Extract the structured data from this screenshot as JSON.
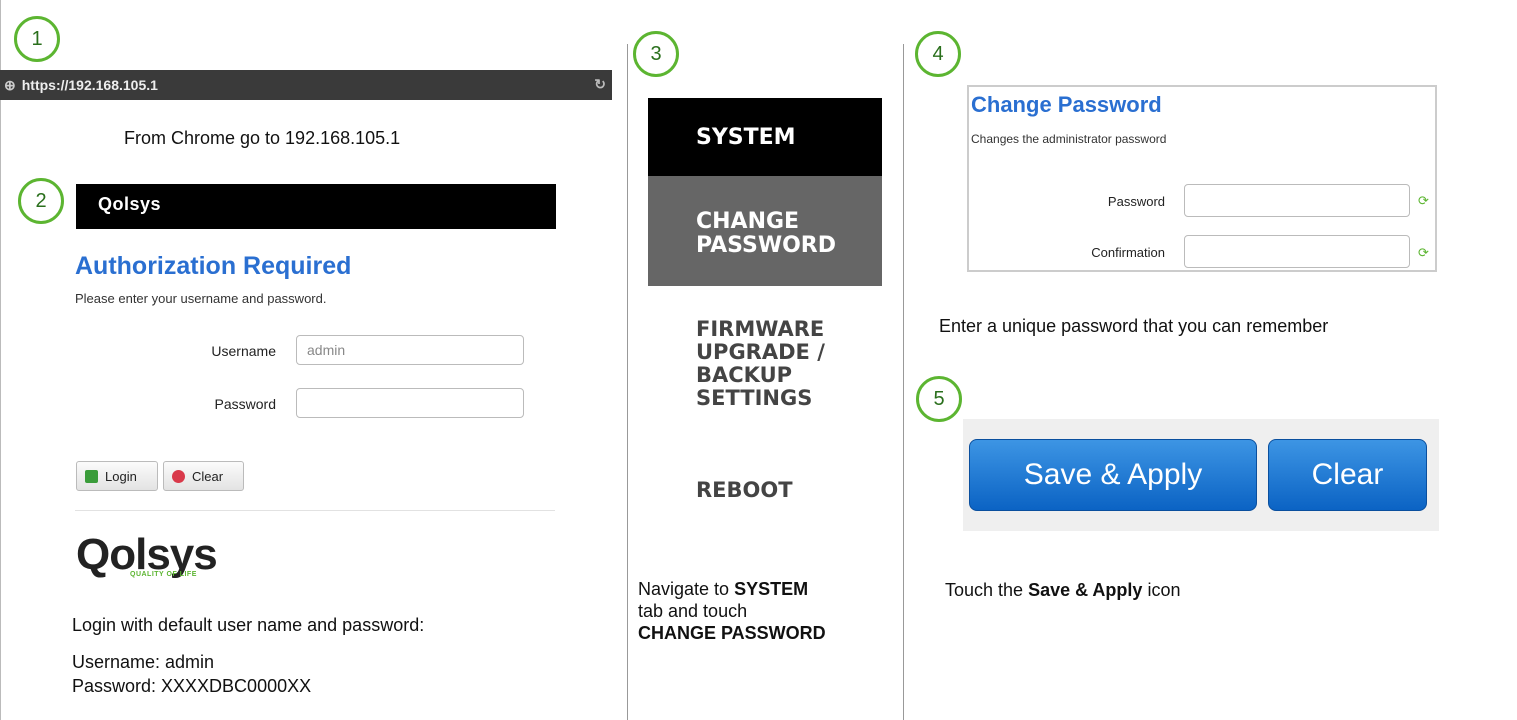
{
  "steps": {
    "one": "1",
    "two": "2",
    "three": "3",
    "four": "4",
    "five": "5"
  },
  "panel1": {
    "url": "https://192.168.105.1",
    "url_caption": "From Chrome go to 192.168.105.1",
    "login_logo": "Qolsys",
    "auth_title": "Authorization Required",
    "auth_subtitle": "Please enter your username and password.",
    "username_label": "Username",
    "username_value": "admin",
    "password_label": "Password",
    "password_value": "",
    "login_button": "Login",
    "clear_button": "Clear",
    "brand_logo": "Qolsys",
    "brand_tagline": "QUALITY OF LIFE",
    "login_caption": "Login with default user name and password:",
    "username_line": "Username: admin",
    "password_line": "Password: XXXXDBC0000XX"
  },
  "panel3": {
    "menu_system": "SYSTEM",
    "menu_change_1": "CHANGE",
    "menu_change_2": "PASSWORD",
    "menu_fw_1": "FIRMWARE",
    "menu_fw_2": "UPGRADE /",
    "menu_fw_3": "BACKUP",
    "menu_fw_4": "SETTINGS",
    "menu_reboot": "REBOOT",
    "nav_text_1": "Navigate to ",
    "nav_bold_1": "SYSTEM",
    "nav_text_2": "tab and touch",
    "nav_bold_2": "CHANGE PASSWORD"
  },
  "panel4": {
    "cp_title": "Change Password",
    "cp_subtitle": "Changes the administrator password",
    "password_label": "Password",
    "confirm_label": "Confirmation",
    "password_value": "",
    "confirm_value": "",
    "enter_caption": "Enter a unique password that you can remember",
    "save_button": "Save & Apply",
    "clear_button": "Clear",
    "touch_text_1": "Touch the ",
    "touch_bold": "Save & Apply",
    "touch_text_2": " icon"
  },
  "colors": {
    "step_ring": "#5cb531",
    "link_blue": "#2a6fd1",
    "button_blue": "#1676d2"
  }
}
